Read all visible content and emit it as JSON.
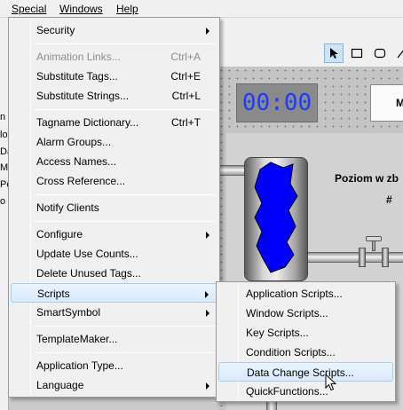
{
  "menubar": {
    "items": [
      {
        "label": "Special"
      },
      {
        "label": "Windows"
      },
      {
        "label": "Help"
      }
    ]
  },
  "background": {
    "left_strip_letters": [
      "n",
      "lo",
      "Da",
      "M",
      "Pc",
      "o"
    ],
    "clock_text": "00:00",
    "button_text": "M",
    "tank_label": "Poziom w zb",
    "value_placeholder": "#"
  },
  "toolbar": {
    "icons": [
      "pointer-icon",
      "rectangle-icon",
      "rounded-rectangle-icon"
    ]
  },
  "menu": {
    "items": [
      {
        "label": "Security",
        "shortcut": "",
        "submenu": true,
        "disabled": false
      },
      {
        "label": "Animation Links...",
        "shortcut": "Ctrl+A",
        "submenu": false,
        "disabled": true
      },
      {
        "label": "Substitute Tags...",
        "shortcut": "Ctrl+E",
        "submenu": false,
        "disabled": false
      },
      {
        "label": "Substitute Strings...",
        "shortcut": "Ctrl+L",
        "submenu": false,
        "disabled": false
      },
      {
        "label": "Tagname Dictionary...",
        "shortcut": "Ctrl+T",
        "submenu": false,
        "disabled": false
      },
      {
        "label": "Alarm Groups...",
        "shortcut": "",
        "submenu": false,
        "disabled": false
      },
      {
        "label": "Access Names...",
        "shortcut": "",
        "submenu": false,
        "disabled": false
      },
      {
        "label": "Cross Reference...",
        "shortcut": "",
        "submenu": false,
        "disabled": false
      },
      {
        "label": "Notify Clients",
        "shortcut": "",
        "submenu": false,
        "disabled": false
      },
      {
        "label": "Configure",
        "shortcut": "",
        "submenu": true,
        "disabled": false
      },
      {
        "label": "Update Use Counts...",
        "shortcut": "",
        "submenu": false,
        "disabled": false
      },
      {
        "label": "Delete Unused Tags...",
        "shortcut": "",
        "submenu": false,
        "disabled": false
      },
      {
        "label": "Scripts",
        "shortcut": "",
        "submenu": true,
        "disabled": false,
        "highlighted": true
      },
      {
        "label": "SmartSymbol",
        "shortcut": "",
        "submenu": true,
        "disabled": false
      },
      {
        "label": "TemplateMaker...",
        "shortcut": "",
        "submenu": false,
        "disabled": false
      },
      {
        "label": "Application Type...",
        "shortcut": "",
        "submenu": false,
        "disabled": false
      },
      {
        "label": "Language",
        "shortcut": "",
        "submenu": true,
        "disabled": false
      }
    ]
  },
  "submenu": {
    "items": [
      {
        "label": "Application Scripts..."
      },
      {
        "label": "Window Scripts..."
      },
      {
        "label": "Key Scripts..."
      },
      {
        "label": "Condition Scripts..."
      },
      {
        "label": "Data Change Scripts...",
        "highlighted": true
      },
      {
        "label": "QuickFunctions..."
      }
    ]
  },
  "colors": {
    "menu_bg": "#f0f0f0",
    "highlight_bg": "#d9eafb",
    "highlight_border": "#a9cdf0",
    "disabled_text": "#8d8d8d",
    "clock_digits": "#1a3cff",
    "tank_fill": "#0000ff"
  }
}
